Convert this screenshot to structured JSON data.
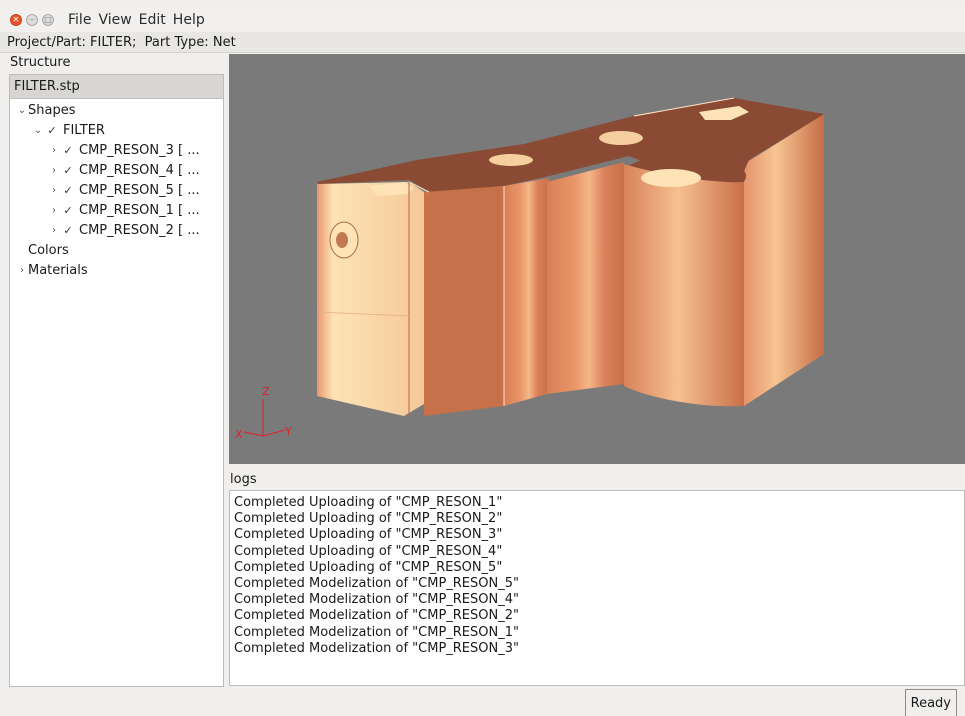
{
  "menubar": {
    "items": [
      "File",
      "View",
      "Edit",
      "Help"
    ]
  },
  "infobar": {
    "project_label": "Project/Part:",
    "project_value": "FILTER;",
    "type_label": "Part Type:",
    "type_value": "Net"
  },
  "structure": {
    "title": "Structure",
    "file": "FILTER.stp",
    "shapes_label": "Shapes",
    "root": "FILTER",
    "children": [
      "CMP_RESON_3 [ ...",
      "CMP_RESON_4 [ ...",
      "CMP_RESON_5 [ ...",
      "CMP_RESON_1 [ ...",
      "CMP_RESON_2 [ ..."
    ],
    "colors_label": "Colors",
    "materials_label": "Materials"
  },
  "viewport": {
    "background": "#7a7a7a",
    "part_light": "#fde3b6",
    "part_mid": "#e28c63",
    "part_dark": "#83452f",
    "axes": {
      "z": "Z",
      "x": "X",
      "y": "Y"
    }
  },
  "logs": {
    "title": "logs",
    "lines": [
      "Completed Uploading of \"CMP_RESON_1\"",
      "Completed Uploading of \"CMP_RESON_2\"",
      "Completed Uploading of \"CMP_RESON_3\"",
      "Completed Uploading of \"CMP_RESON_4\"",
      "Completed Uploading of \"CMP_RESON_5\"",
      "Completed Modelization of \"CMP_RESON_5\"",
      "Completed Modelization of \"CMP_RESON_4\"",
      "Completed Modelization of \"CMP_RESON_2\"",
      "Completed Modelization of \"CMP_RESON_1\"",
      "Completed Modelization of \"CMP_RESON_3\""
    ]
  },
  "status": {
    "text": "Ready"
  }
}
